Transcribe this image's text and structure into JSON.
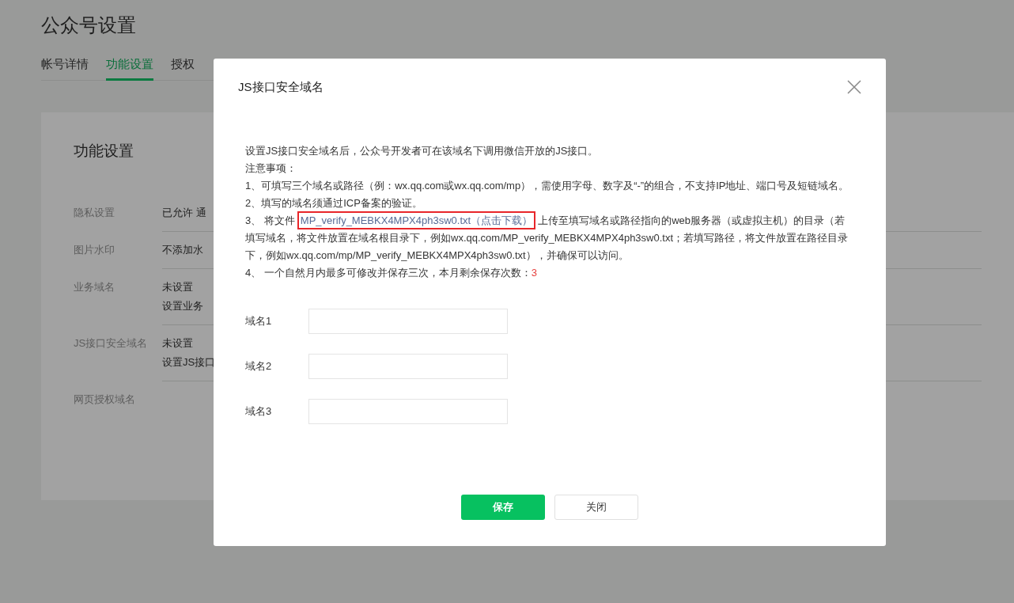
{
  "page": {
    "title": "公众号设置",
    "tabs": [
      {
        "label": "帐号详情",
        "selected": false
      },
      {
        "label": "功能设置",
        "selected": true
      },
      {
        "label": "授权",
        "selected": false
      }
    ]
  },
  "card": {
    "title": "功能设置",
    "rows": [
      {
        "label": "隐私设置",
        "values": [
          "已允许 通"
        ]
      },
      {
        "label": "图片水印",
        "values": [
          "不添加水"
        ]
      },
      {
        "label": "业务域名",
        "values": [
          "未设置",
          "设置业务"
        ]
      },
      {
        "label": "JS接口安全域名",
        "values": [
          "未设置",
          "设置JS接口"
        ]
      },
      {
        "label": "网页授权域名",
        "values": []
      }
    ]
  },
  "dialog": {
    "title": "JS接口安全域名",
    "intro": "设置JS接口安全域名后，公众号开发者可在该域名下调用微信开放的JS接口。",
    "notes_heading": "注意事项：",
    "note_1": "1、可填写三个域名或路径（例：wx.qq.com或wx.qq.com/mp），需使用字母、数字及“-”的组合，不支持IP地址、端口号及短链域名。",
    "note_2": "2、填写的域名须通过ICP备案的验证。",
    "note_3": {
      "before": "3、 将文件",
      "link": "MP_verify_MEBKX4MPX4ph3sw0.txt（点击下载）",
      "after": "上传至填写域名或路径指向的web服务器（或虚拟主机）的目录（若填写域名，将文件放置在域名根目录下，例如wx.qq.com/MP_verify_MEBKX4MPX4ph3sw0.txt；若填写路径，将文件放置在路径目录下，例如wx.qq.com/mp/MP_verify_MEBKX4MPX4ph3sw0.txt），并确保可以访问。"
    },
    "note_4": {
      "text": "4、 一个自然月内最多可修改并保存三次，本月剩余保存次数：",
      "count": "3"
    },
    "fields": [
      {
        "label": "域名1"
      },
      {
        "label": "域名2"
      },
      {
        "label": "域名3"
      }
    ],
    "buttons": [
      {
        "label": "保存",
        "kind": "primary"
      },
      {
        "label": "关闭",
        "kind": "default"
      }
    ]
  }
}
